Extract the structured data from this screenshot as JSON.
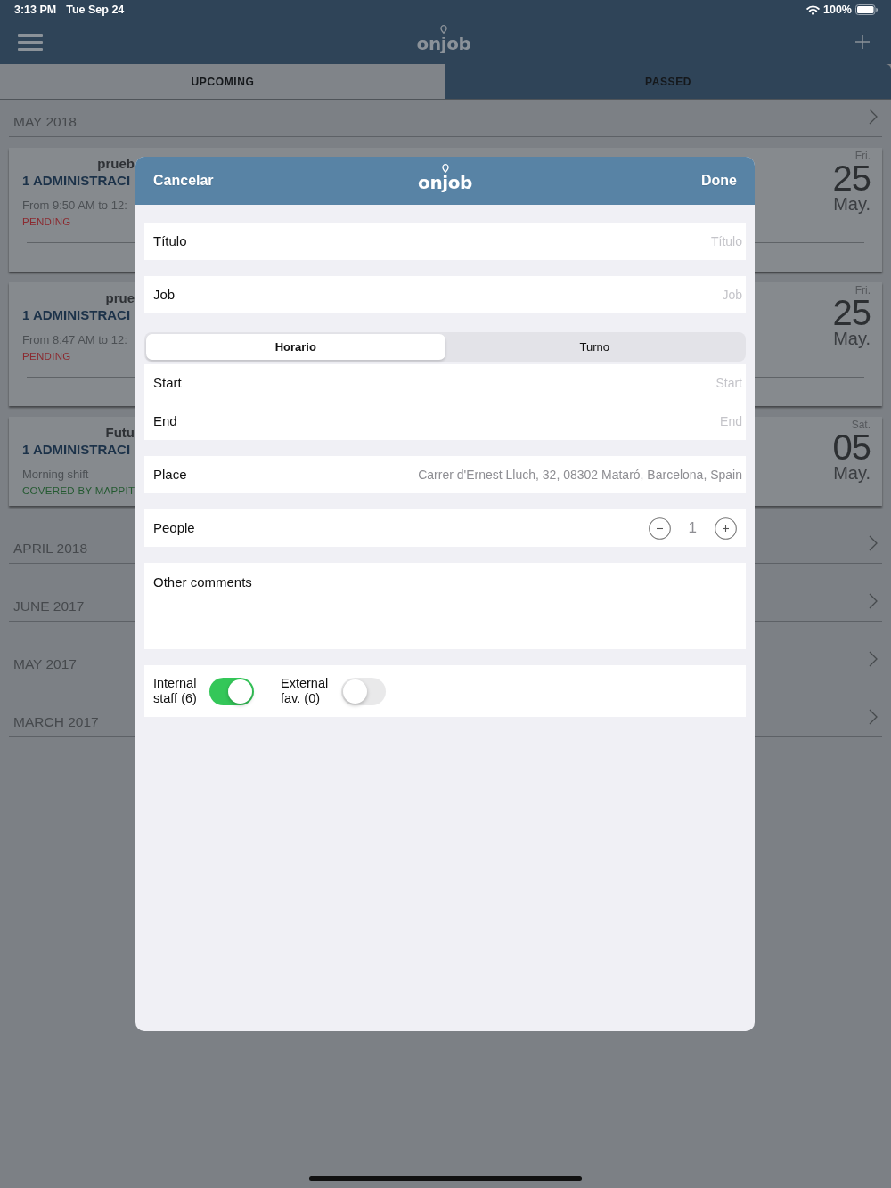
{
  "status_bar": {
    "time": "3:13 PM",
    "date": "Tue Sep 24",
    "battery": "100%"
  },
  "nav_bar": {
    "logo": "onjob"
  },
  "tabs": [
    {
      "label": "UPCOMING",
      "selected": false
    },
    {
      "label": "PASSED",
      "selected": true
    }
  ],
  "sections": [
    {
      "title": "MAY 2018",
      "shifts": [
        {
          "kind": "pending",
          "title": "prueb",
          "position": "1 ADMINISTRACI",
          "detail": "From 9:50 AM to 12:",
          "status": "PENDING",
          "weekday": "Fri.",
          "day": "25",
          "month": "May."
        },
        {
          "kind": "pending",
          "title": "prue",
          "position": "1 ADMINISTRACI",
          "detail": "From 8:47 AM to 12:",
          "status": "PENDING",
          "weekday": "Fri.",
          "day": "25",
          "month": "May."
        },
        {
          "kind": "covered",
          "title": "Futu",
          "position": "1 ADMINISTRACI",
          "detail": "Morning shift",
          "status": "COVERED BY MAPPIT",
          "weekday": "Sat.",
          "day": "05",
          "month": "May."
        }
      ]
    },
    {
      "title": "APRIL 2018"
    },
    {
      "title": "JUNE 2017"
    },
    {
      "title": "MAY 2017"
    },
    {
      "title": "MARCH 2017"
    }
  ],
  "modal": {
    "cancel": "Cancelar",
    "logo": "onjob",
    "done": "Done",
    "fields": [
      {
        "label": "Título",
        "placeholder": "Título"
      },
      {
        "label": "Job",
        "placeholder": "Job"
      }
    ],
    "segments": [
      {
        "label": "Horario",
        "selected": true
      },
      {
        "label": "Turno",
        "selected": false
      }
    ],
    "schedule": [
      {
        "label": "Start",
        "placeholder": "Start"
      },
      {
        "label": "End",
        "placeholder": "End"
      }
    ],
    "place": {
      "label": "Place",
      "value": "Carrer d'Ernest Lluch, 32, 08302 Mataró, Barcelona, Spain"
    },
    "people": {
      "label": "People",
      "count": "1"
    },
    "comments": {
      "label": "Other comments"
    },
    "toggles": [
      {
        "label": "Internal staff (6)",
        "on": true
      },
      {
        "label": "External fav. (0)",
        "on": false
      }
    ]
  }
}
